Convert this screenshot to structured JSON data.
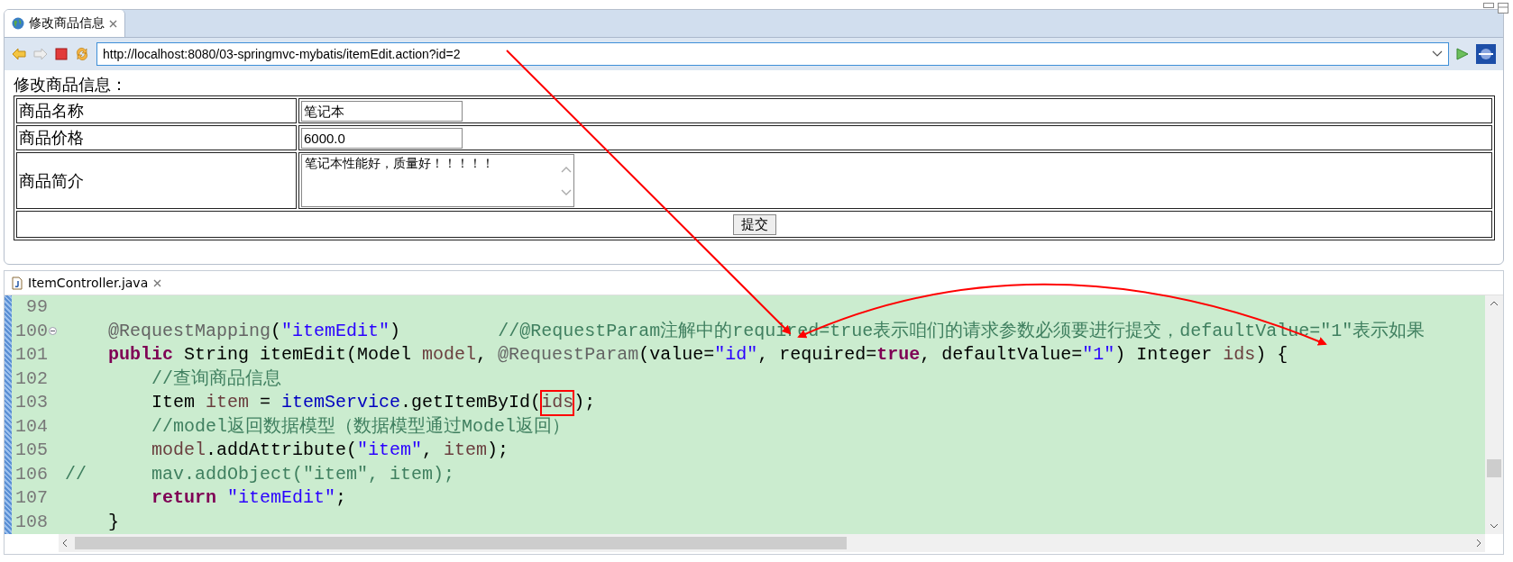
{
  "browser": {
    "tab": {
      "title": "修改商品信息",
      "selected": true
    },
    "url": "http://localhost:8080/03-springmvc-mybatis/itemEdit.action?id=2"
  },
  "form": {
    "heading": "修改商品信息：",
    "rows": [
      {
        "label": "商品名称",
        "kind": "text",
        "value": "笔记本"
      },
      {
        "label": "商品价格",
        "kind": "text",
        "value": "6000.0"
      },
      {
        "label": "商品简介",
        "kind": "textarea",
        "value": "笔记本性能好，质量好！！！！！"
      }
    ],
    "submit": "提交"
  },
  "editor": {
    "tab": {
      "title": "ItemController.java",
      "selected": true
    },
    "lines": [
      {
        "number": "99"
      },
      {
        "number": "100",
        "expanded": true,
        "tokens": [
          {
            "t": "    @RequestMapping",
            "kind": "ann"
          },
          {
            "t": "(",
            "kind": "plain"
          },
          {
            "t": "\"itemEdit\"",
            "kind": "str"
          },
          {
            "t": ")         ",
            "kind": "plain"
          },
          {
            "t": "//@RequestParam注解中的required=true表示咱们的请求参数必须要进行提交，defaultValue=\"1\"表示如果",
            "kind": "cmt"
          }
        ]
      },
      {
        "number": "101",
        "tokens": [
          {
            "t": "    public",
            "kind": "kw"
          },
          {
            "t": " String itemEdit(Model ",
            "kind": "plain"
          },
          {
            "t": "model",
            "kind": "var"
          },
          {
            "t": ", ",
            "kind": "plain"
          },
          {
            "t": "@RequestParam",
            "kind": "ann"
          },
          {
            "t": "(value=",
            "kind": "plain"
          },
          {
            "t": "\"id\"",
            "kind": "str"
          },
          {
            "t": ", required=",
            "kind": "plain"
          },
          {
            "t": "true",
            "kind": "kw"
          },
          {
            "t": ", defaultValue=",
            "kind": "plain"
          },
          {
            "t": "\"1\"",
            "kind": "str"
          },
          {
            "t": ") Integer ",
            "kind": "plain"
          },
          {
            "t": "ids",
            "kind": "var"
          },
          {
            "t": ") {",
            "kind": "plain"
          }
        ]
      },
      {
        "number": "102",
        "tokens": [
          {
            "t": "        //查询商品信息",
            "kind": "cmt"
          }
        ]
      },
      {
        "number": "103",
        "tokens": [
          {
            "t": "        Item ",
            "kind": "plain"
          },
          {
            "t": "item",
            "kind": "var"
          },
          {
            "t": " = ",
            "kind": "plain"
          },
          {
            "t": "itemService",
            "kind": "field"
          },
          {
            "t": ".getItemById(",
            "kind": "plain"
          },
          {
            "t": "ids",
            "kind": "var",
            "boxed": true
          },
          {
            "t": ");",
            "kind": "plain"
          }
        ]
      },
      {
        "number": "104",
        "tokens": [
          {
            "t": "        //model返回数据模型（数据模型通过Model返回）",
            "kind": "cmt"
          }
        ]
      },
      {
        "number": "105",
        "tokens": [
          {
            "t": "        model",
            "kind": "var"
          },
          {
            "t": ".addAttribute(",
            "kind": "plain"
          },
          {
            "t": "\"item\"",
            "kind": "str"
          },
          {
            "t": ", ",
            "kind": "plain"
          },
          {
            "t": "item",
            "kind": "var"
          },
          {
            "t": ");",
            "kind": "plain"
          }
        ]
      },
      {
        "number": "106",
        "tokens": [
          {
            "t": "//      mav.addObject(\"item\", item);",
            "kind": "cmt"
          }
        ]
      },
      {
        "number": "107",
        "tokens": [
          {
            "t": "        return",
            "kind": "kw"
          },
          {
            "t": " \"itemEdit\"",
            "kind": "str"
          },
          {
            "t": ";",
            "kind": "plain"
          }
        ]
      },
      {
        "number": "108",
        "tokens": [
          {
            "t": "    }",
            "kind": "plain"
          }
        ]
      }
    ]
  }
}
